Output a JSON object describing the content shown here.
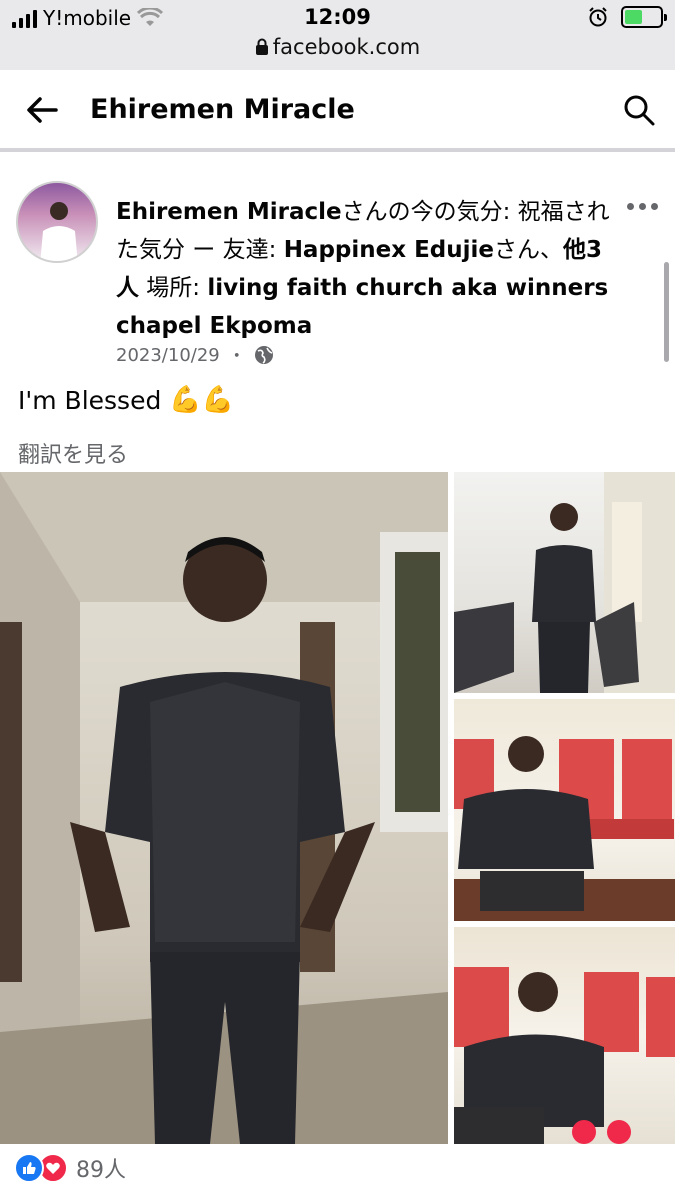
{
  "status_bar": {
    "carrier": "Y!mobile",
    "time": "12:09",
    "url": "facebook.com",
    "battery_level": 0.5
  },
  "header": {
    "title": "Ehiremen Miracle"
  },
  "post": {
    "author": "Ehiremen Miracle",
    "feeling_text": "さんの今の気分: 祝福された気分 ー 友達: ",
    "friend": "Happinex Edujie",
    "friend_suffix": "さん、",
    "others": "他3人",
    "location_prefix": " 場所: ",
    "location": "living faith church aka winners chapel Ekpoma",
    "date": "2023/10/29",
    "date_separator": "・",
    "audience_icon": "globe-icon",
    "text": "I'm Blessed",
    "emoji": "💪💪",
    "translate_label": "翻訳を見る"
  },
  "reactions": {
    "count": "89人",
    "types": [
      "like",
      "love"
    ]
  },
  "colors": {
    "facebook_blue": "#1877f2",
    "love_red": "#f02849",
    "secondary_text": "#65676b"
  }
}
